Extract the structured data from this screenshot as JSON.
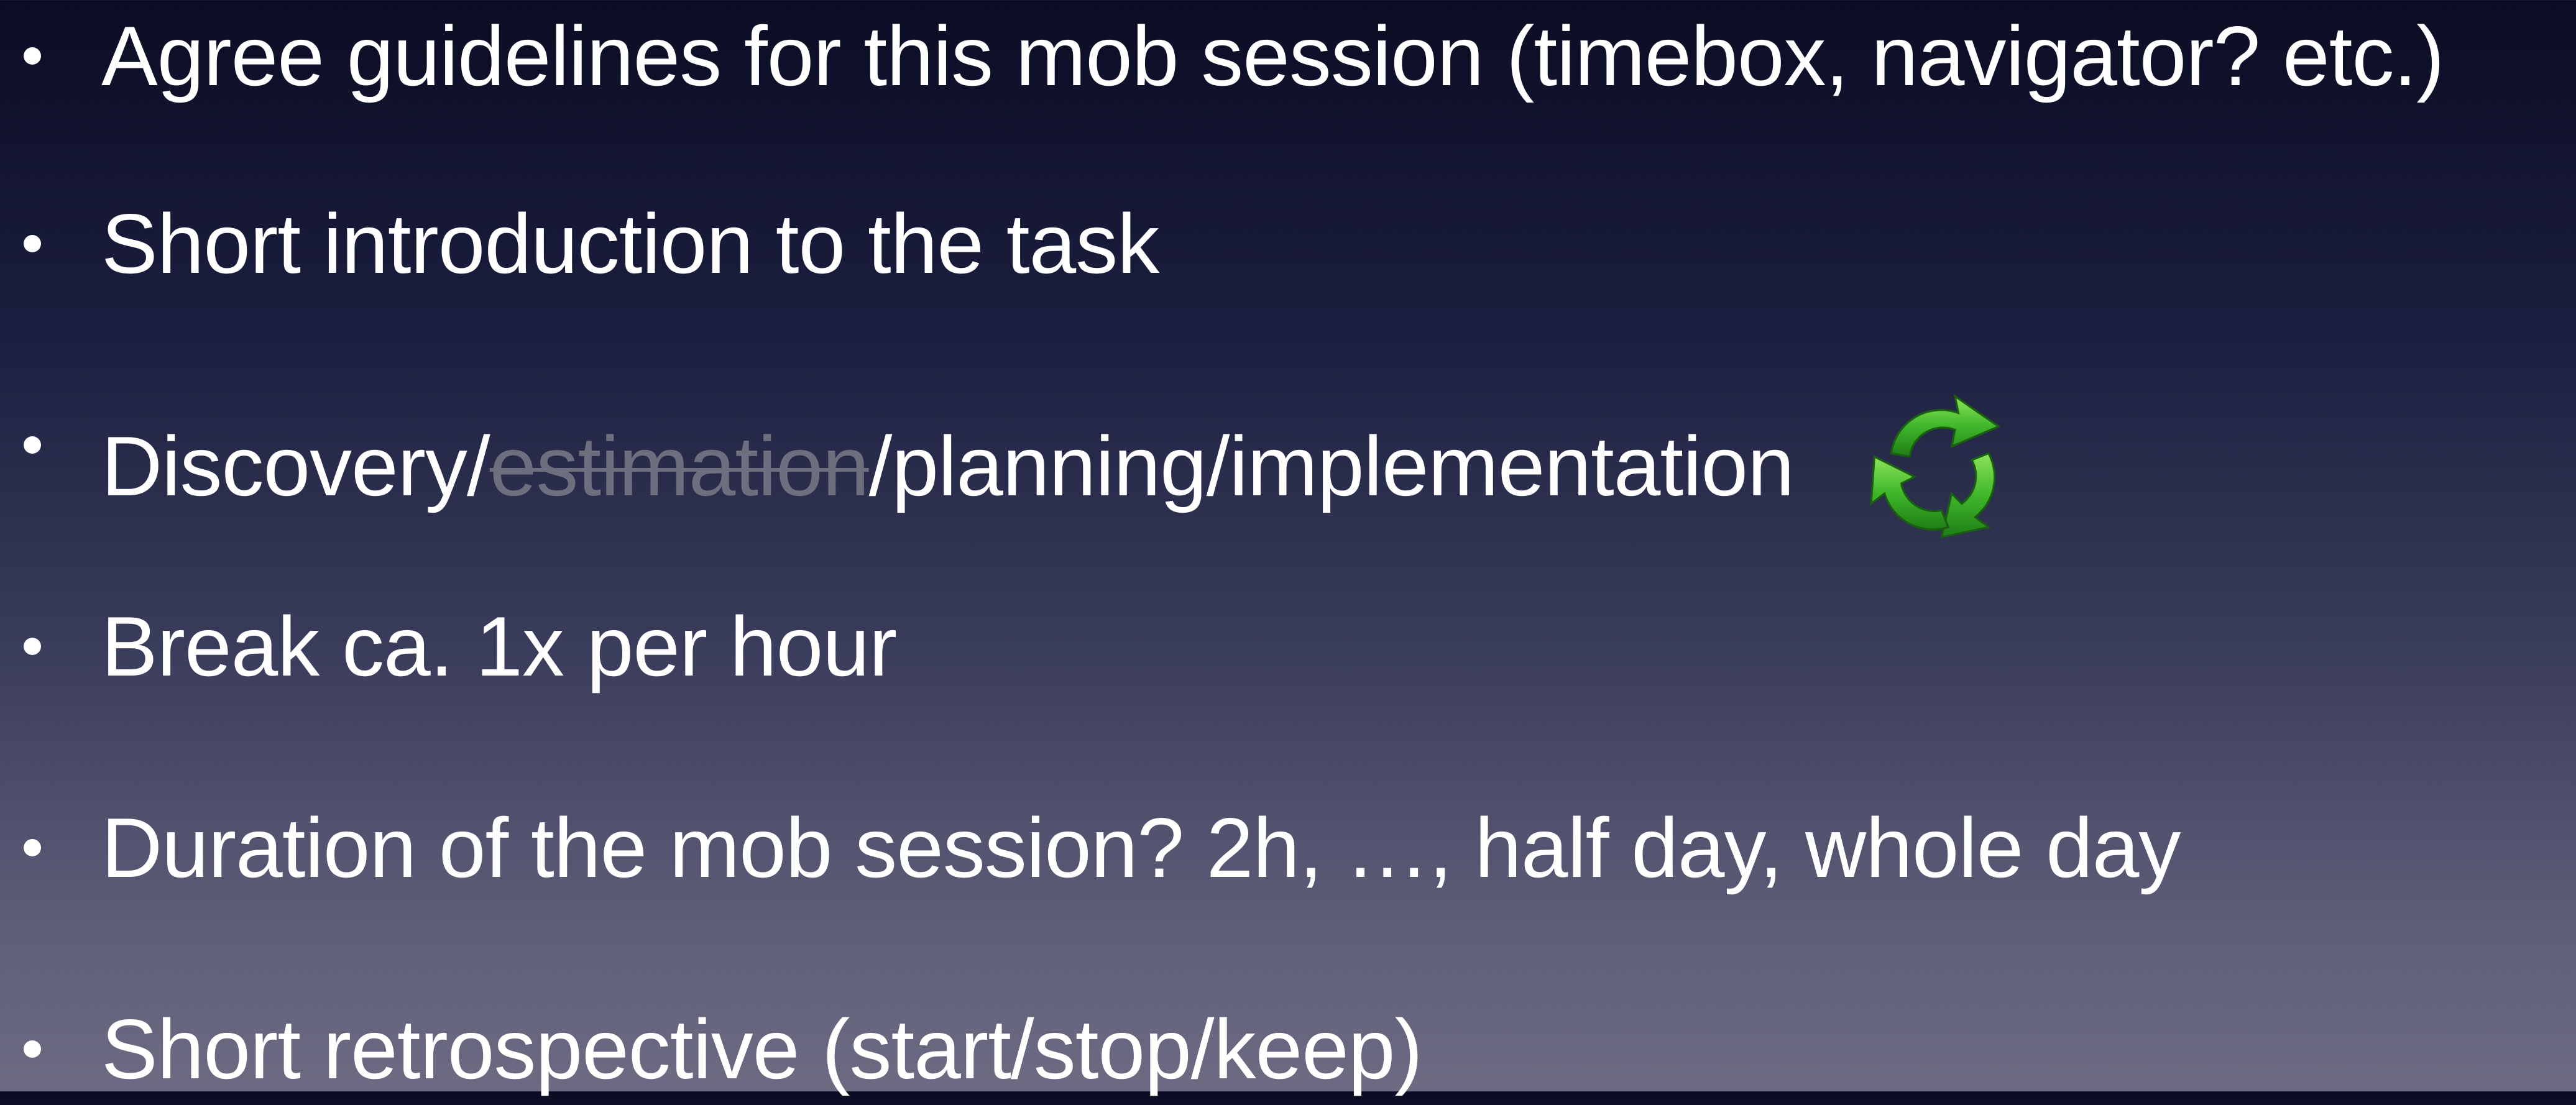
{
  "bullets": [
    {
      "text": "Agree guidelines for this mob session (timebox, navigator? etc.)"
    },
    {
      "text": "Short introduction to the task"
    },
    {
      "prefix": "Discovery/",
      "struck": "estimation",
      "suffix": "/planning/implementation",
      "icon": "cycle-arrows-icon"
    },
    {
      "text": "Break ca. 1x per hour"
    },
    {
      "text": "Duration of the mob session? 2h, …, half day, whole day"
    },
    {
      "text": "Short retrospective (start/stop/keep)"
    }
  ],
  "colors": {
    "text": "#ffffff",
    "struck_text": "#6d6f7e",
    "icon_green": "#3fb72a",
    "background_top": "#0b0d24",
    "background_bottom": "#6c6b82"
  }
}
